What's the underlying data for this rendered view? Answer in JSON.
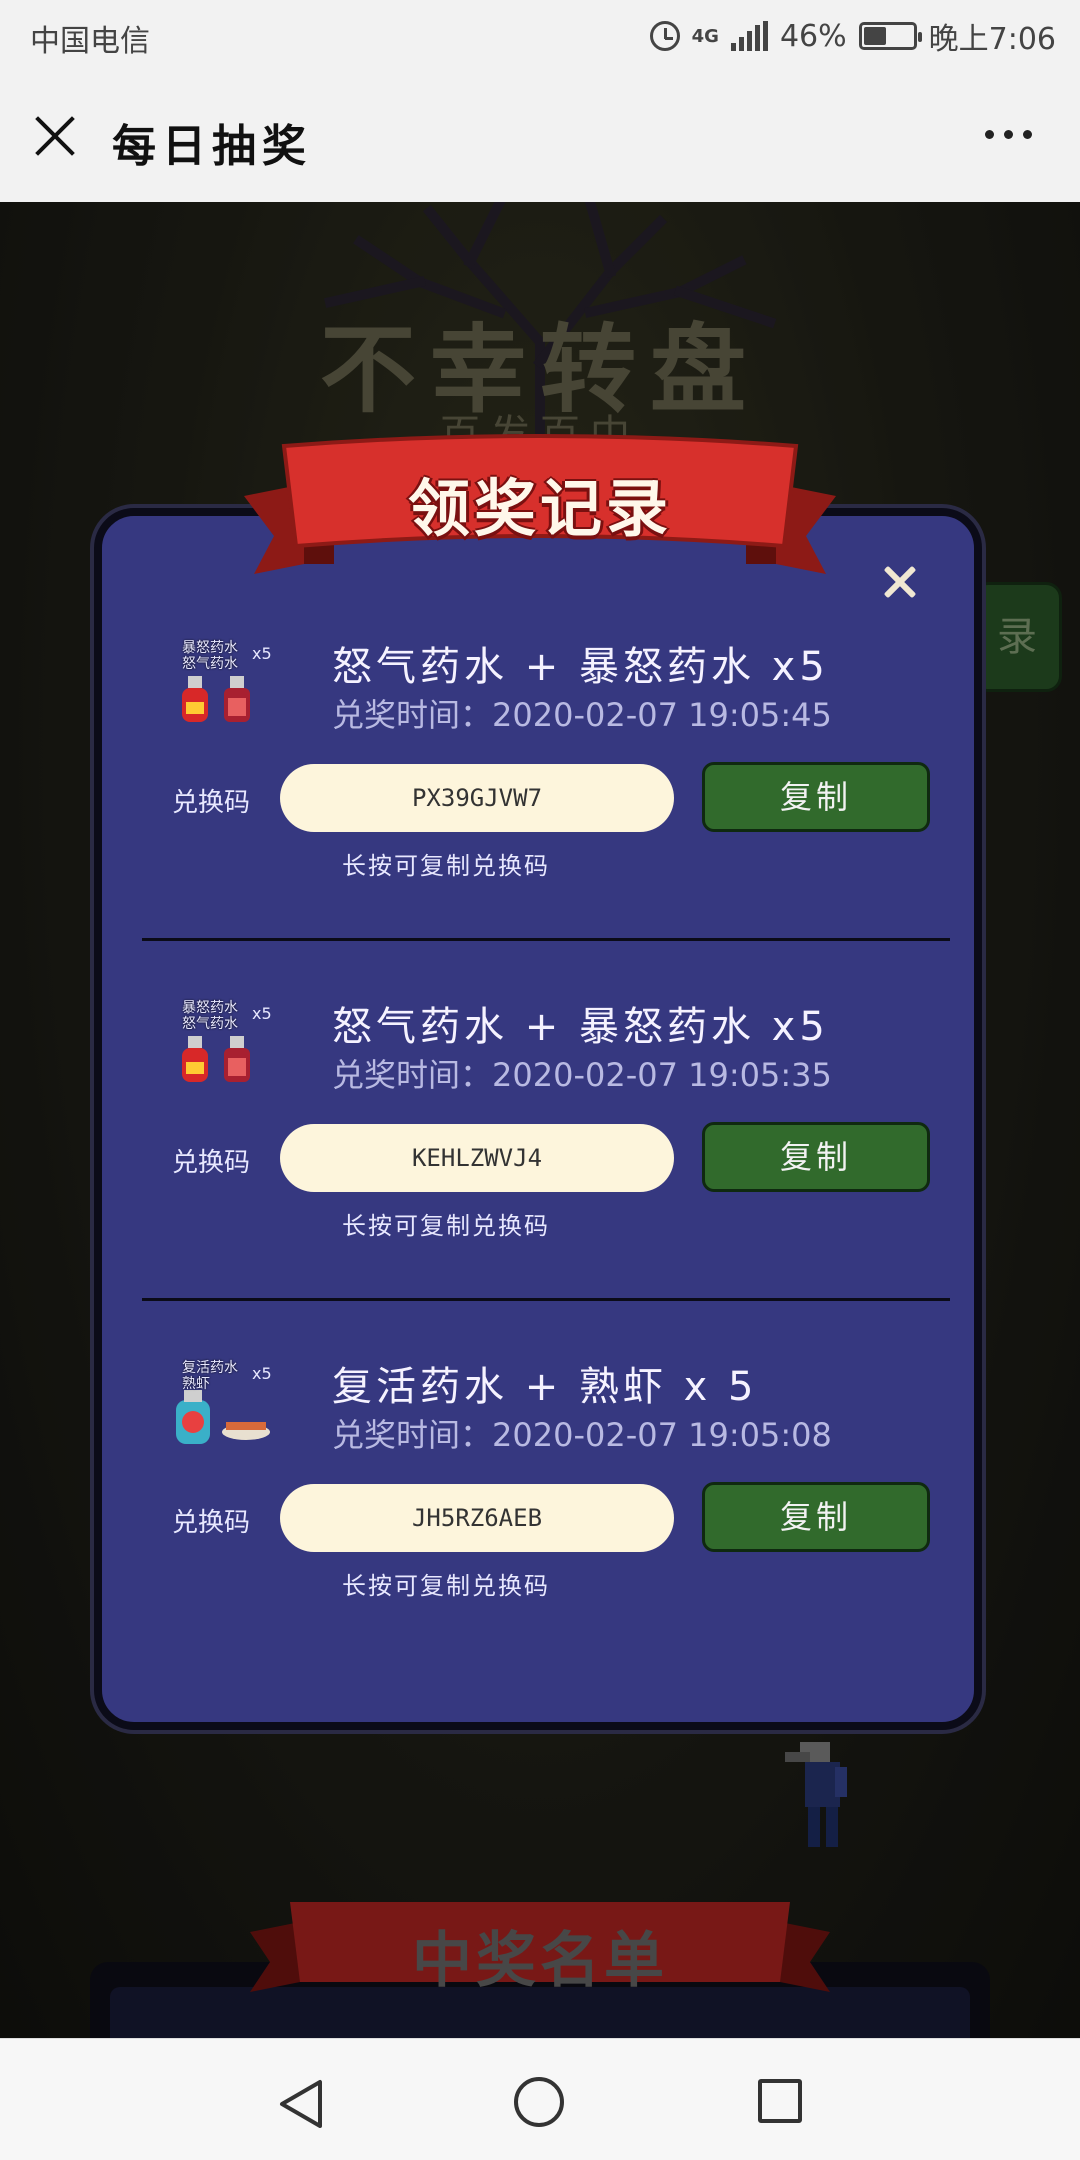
{
  "status_bar": {
    "carrier": "中国电信",
    "network": "4G",
    "battery": "46%",
    "time": "晚上7:06",
    "battery_level": 0.46
  },
  "title_bar": {
    "title": "每日抽奖"
  },
  "background": {
    "game_title": "不幸转盘",
    "game_subtitle": "百发百中",
    "side_tab": "录",
    "bottom_banner": "中奖名单"
  },
  "modal": {
    "banner_title": "领奖记录",
    "records": [
      {
        "prize": "怒气药水 + 暴怒药水 x5",
        "time": "兑奖时间：2020-02-07 19:05:45",
        "icon_label": [
          "暴怒药水",
          "怒气药水"
        ],
        "icon_qty": "x5",
        "code_label": "兑换码",
        "code": "PX39GJVW7",
        "copy_label": "复制",
        "hint": "长按可复制兑换码"
      },
      {
        "prize": "怒气药水 + 暴怒药水 x5",
        "time": "兑奖时间：2020-02-07 19:05:35",
        "icon_label": [
          "暴怒药水",
          "怒气药水"
        ],
        "icon_qty": "x5",
        "code_label": "兑换码",
        "code": "KEHLZWVJ4",
        "copy_label": "复制",
        "hint": "长按可复制兑换码"
      },
      {
        "prize": "复活药水 + 熟虾 x 5",
        "time": "兑奖时间：2020-02-07 19:05:08",
        "icon_label": [
          "复活药水",
          "熟虾"
        ],
        "icon_qty": "x5",
        "code_label": "兑换码",
        "code": "JH5RZ6AEB",
        "copy_label": "复制",
        "hint": "长按可复制兑换码"
      }
    ]
  },
  "colors": {
    "modal_bg": "#363880",
    "ribbon_red": "#d7302c",
    "copy_button": "#316a2c",
    "code_field": "#fdf5dc"
  }
}
